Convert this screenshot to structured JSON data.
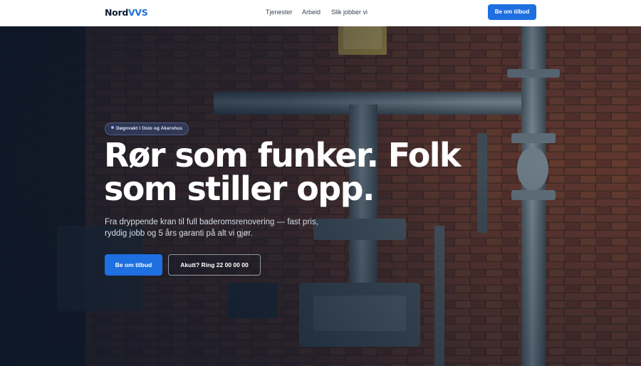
{
  "brand": {
    "name_prefix": "Nord",
    "name_suffix": "VVS",
    "accent_color": "#1f6fd6"
  },
  "nav": {
    "items": [
      {
        "label": "Tjenester"
      },
      {
        "label": "Arbeid"
      },
      {
        "label": "Slik jobber vi"
      }
    ],
    "cta_label": "Be om tilbud"
  },
  "hero": {
    "badge": "Døgnvakt i Oslo og Akershus",
    "headline_line1": "Rør som funker. Folk",
    "headline_line2": "som stiller opp.",
    "subtext": "Fra dryppende kran til full baderomsrenovering — fast pris, ryddig jobb og 5 års garanti på alt vi gjør.",
    "primary_cta": "Be om tilbud",
    "secondary_cta": "Akutt? Ring 22 00 00 00",
    "background_image": "brick-wall-with-grey-pipes-photo"
  },
  "colors": {
    "primary": "#1e6fe0",
    "ink": "#0f1b2d",
    "hero_overlay": "#0a1628"
  }
}
